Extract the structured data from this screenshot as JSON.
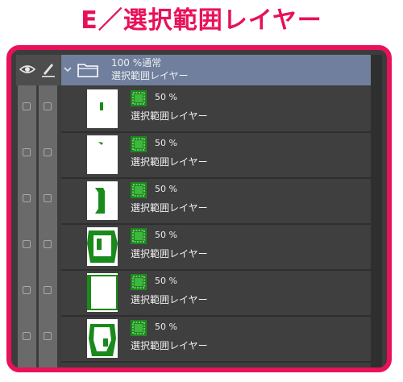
{
  "title": {
    "text": "E／選択範囲レイヤー",
    "color": "#e8115a"
  },
  "colors": {
    "frame": "#e8115a",
    "folder_highlight": "#6f7f9d",
    "panel_bg": "#3c3c3c",
    "mask_green": "#1a8a1a"
  },
  "header": {
    "eye_icon": "eye-icon",
    "pen_icon": "pen-icon",
    "folder": {
      "chevron_icon": "chevron-down-icon",
      "icon": "folder-icon",
      "blend_label": "100 %通常",
      "name": "選択範囲レイヤー"
    }
  },
  "layers": [
    {
      "opacity": "50 %",
      "name": "選択範囲レイヤー",
      "thumb_icon": "selection-thumbnail"
    },
    {
      "opacity": "50 %",
      "name": "選択範囲レイヤー",
      "thumb_icon": "selection-thumbnail"
    },
    {
      "opacity": "50 %",
      "name": "選択範囲レイヤー",
      "thumb_icon": "selection-thumbnail"
    },
    {
      "opacity": "50 %",
      "name": "選択範囲レイヤー",
      "thumb_icon": "selection-thumbnail"
    },
    {
      "opacity": "50 %",
      "name": "選択範囲レイヤー",
      "thumb_icon": "selection-thumbnail"
    },
    {
      "opacity": "50 %",
      "name": "選択範囲レイヤー",
      "thumb_icon": "selection-thumbnail"
    }
  ]
}
